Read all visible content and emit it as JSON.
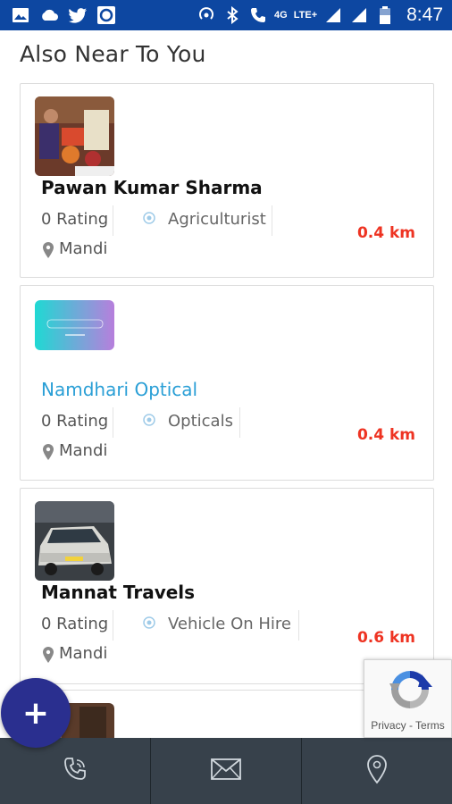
{
  "status_bar": {
    "network_label": "4G",
    "lte_label": "LTE+",
    "time": "8:47",
    "bg_color": "#0d47a1"
  },
  "section_title": "Also Near To You",
  "listings": [
    {
      "name": "Pawan Kumar Sharma",
      "rating": "0 Rating",
      "category": "Agriculturist",
      "location": "Mandi",
      "distance": "0.4 km"
    },
    {
      "name": "Namdhari Optical",
      "rating": "0 Rating",
      "category": "Opticals",
      "location": "Mandi",
      "distance": "0.4 km"
    },
    {
      "name": "Mannat Travels",
      "rating": "0 Rating",
      "category": "Vehicle On Hire",
      "location": "Mandi",
      "distance": "0.6 km"
    }
  ],
  "fab_label": "+",
  "recaptcha": {
    "links": "Privacy - Terms"
  },
  "bottom_nav": {
    "items": [
      "phone-icon",
      "mail-icon",
      "location-pin-icon"
    ]
  },
  "colors": {
    "accent_link": "#2a9fd6",
    "distance": "#ee3322",
    "fab": "#2a2f8f",
    "bottom_bar": "#37414b"
  }
}
